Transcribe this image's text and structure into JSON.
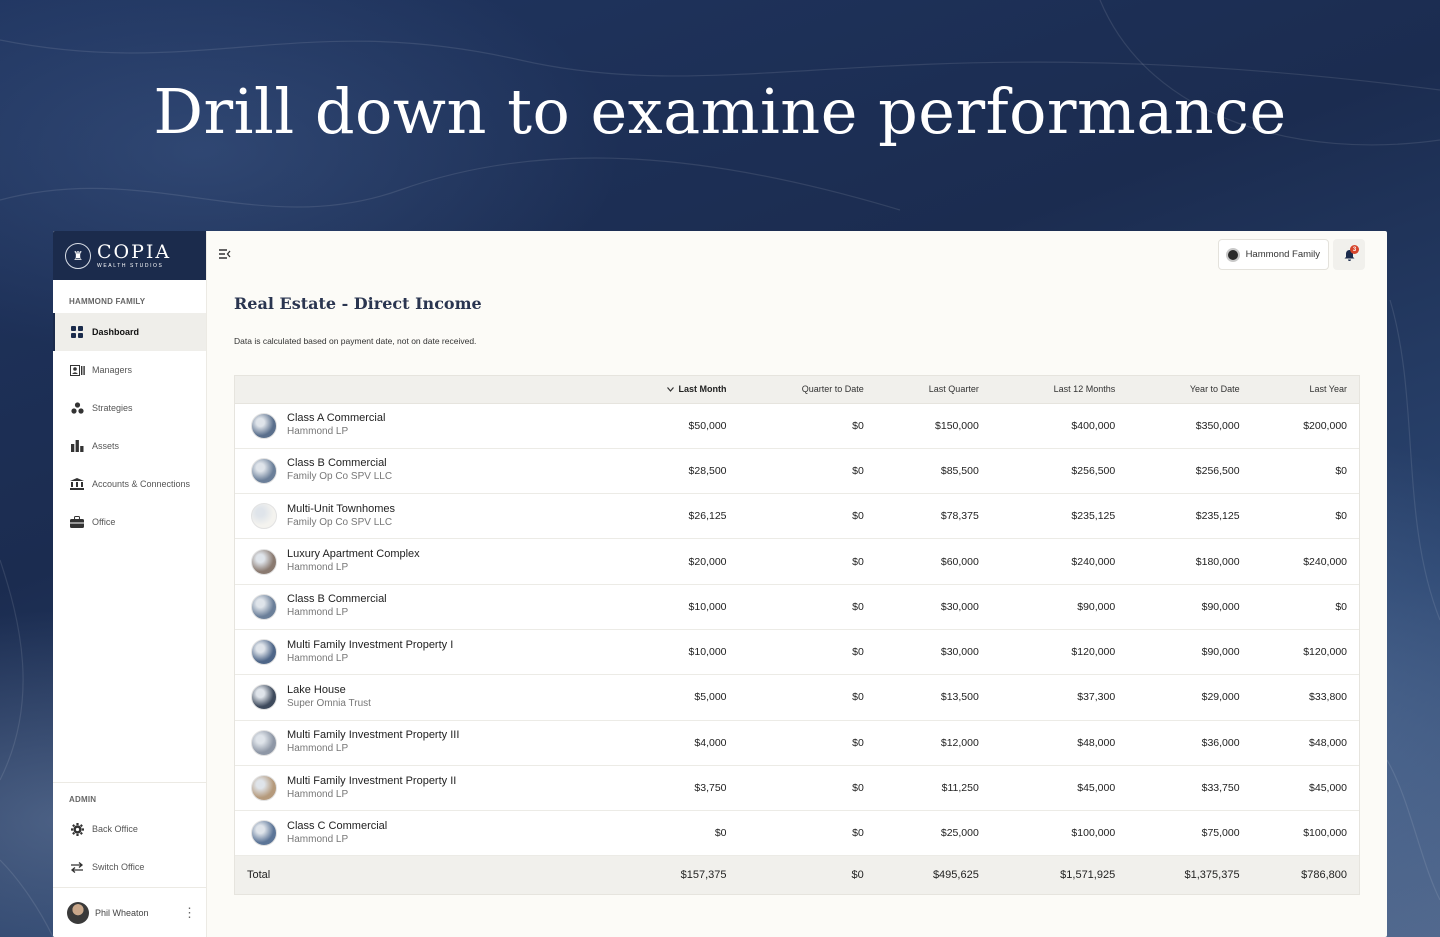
{
  "headline": "Drill down to examine performance",
  "brand": {
    "name": "COPIA",
    "sub": "WEALTH STUDIOS"
  },
  "sidebar": {
    "section_label": "HAMMOND FAMILY",
    "items": [
      {
        "label": "Dashboard",
        "icon": "grid-icon",
        "active": true
      },
      {
        "label": "Managers",
        "icon": "managers-icon"
      },
      {
        "label": "Strategies",
        "icon": "strategies-icon"
      },
      {
        "label": "Assets",
        "icon": "bar-chart-icon"
      },
      {
        "label": "Accounts & Connections",
        "icon": "bank-icon"
      },
      {
        "label": "Office",
        "icon": "briefcase-icon"
      }
    ],
    "admin_label": "ADMIN",
    "admin_items": [
      {
        "label": "Back Office",
        "icon": "gear-icon"
      },
      {
        "label": "Switch Office",
        "icon": "swap-icon"
      }
    ],
    "user": {
      "name": "Phil Wheaton"
    }
  },
  "topbar": {
    "family_label": "Hammond Family",
    "notification_count": "3"
  },
  "page": {
    "title": "Real Estate - Direct Income",
    "note": "Data is calculated based on payment date, not on date received."
  },
  "table": {
    "columns": [
      "Last Month",
      "Quarter to Date",
      "Last Quarter",
      "Last 12 Months",
      "Year to Date",
      "Last Year"
    ],
    "sorted_column": "Last Month",
    "rows": [
      {
        "name": "Class A Commercial",
        "owner": "Hammond LP",
        "thumb": "#5a6f8c",
        "values": [
          "$50,000",
          "$0",
          "$150,000",
          "$400,000",
          "$350,000",
          "$200,000"
        ]
      },
      {
        "name": "Class B Commercial",
        "owner": "Family Op Co SPV LLC",
        "thumb": "#6b7f99",
        "values": [
          "$28,500",
          "$0",
          "$85,500",
          "$256,500",
          "$256,500",
          "$0"
        ]
      },
      {
        "name": "Multi-Unit Townhomes",
        "owner": "Family Op Co SPV LLC",
        "thumb": "#f4f3ef",
        "values": [
          "$26,125",
          "$0",
          "$78,375",
          "$235,125",
          "$235,125",
          "$0"
        ]
      },
      {
        "name": "Luxury Apartment Complex",
        "owner": "Hammond LP",
        "thumb": "#8a7a70",
        "values": [
          "$20,000",
          "$0",
          "$60,000",
          "$240,000",
          "$180,000",
          "$240,000"
        ]
      },
      {
        "name": "Class B Commercial",
        "owner": "Hammond LP",
        "thumb": "#6b7f99",
        "values": [
          "$10,000",
          "$0",
          "$30,000",
          "$90,000",
          "$90,000",
          "$0"
        ]
      },
      {
        "name": "Multi Family Investment Property I",
        "owner": "Hammond LP",
        "thumb": "#4e6688",
        "values": [
          "$10,000",
          "$0",
          "$30,000",
          "$120,000",
          "$90,000",
          "$120,000"
        ]
      },
      {
        "name": "Lake House",
        "owner": "Super Omnia Trust",
        "thumb": "#3e4a5c",
        "values": [
          "$5,000",
          "$0",
          "$13,500",
          "$37,300",
          "$29,000",
          "$33,800"
        ]
      },
      {
        "name": "Multi Family Investment Property III",
        "owner": "Hammond LP",
        "thumb": "#8e97a6",
        "values": [
          "$4,000",
          "$0",
          "$12,000",
          "$48,000",
          "$36,000",
          "$48,000"
        ]
      },
      {
        "name": "Multi Family Investment Property II",
        "owner": "Hammond LP",
        "thumb": "#b59a7c",
        "values": [
          "$3,750",
          "$0",
          "$11,250",
          "$45,000",
          "$33,750",
          "$45,000"
        ]
      },
      {
        "name": "Class C Commercial",
        "owner": "Hammond LP",
        "thumb": "#5c7597",
        "values": [
          "$0",
          "$0",
          "$25,000",
          "$100,000",
          "$75,000",
          "$100,000"
        ]
      }
    ],
    "total": {
      "label": "Total",
      "values": [
        "$157,375",
        "$0",
        "$495,625",
        "$1,571,925",
        "$1,375,375",
        "$786,800"
      ]
    }
  },
  "colors": {
    "navy": "#1b2b4c",
    "page_bg": "#fcfbf7",
    "header_bg": "#f1f0ec",
    "badge": "#d6452c"
  }
}
